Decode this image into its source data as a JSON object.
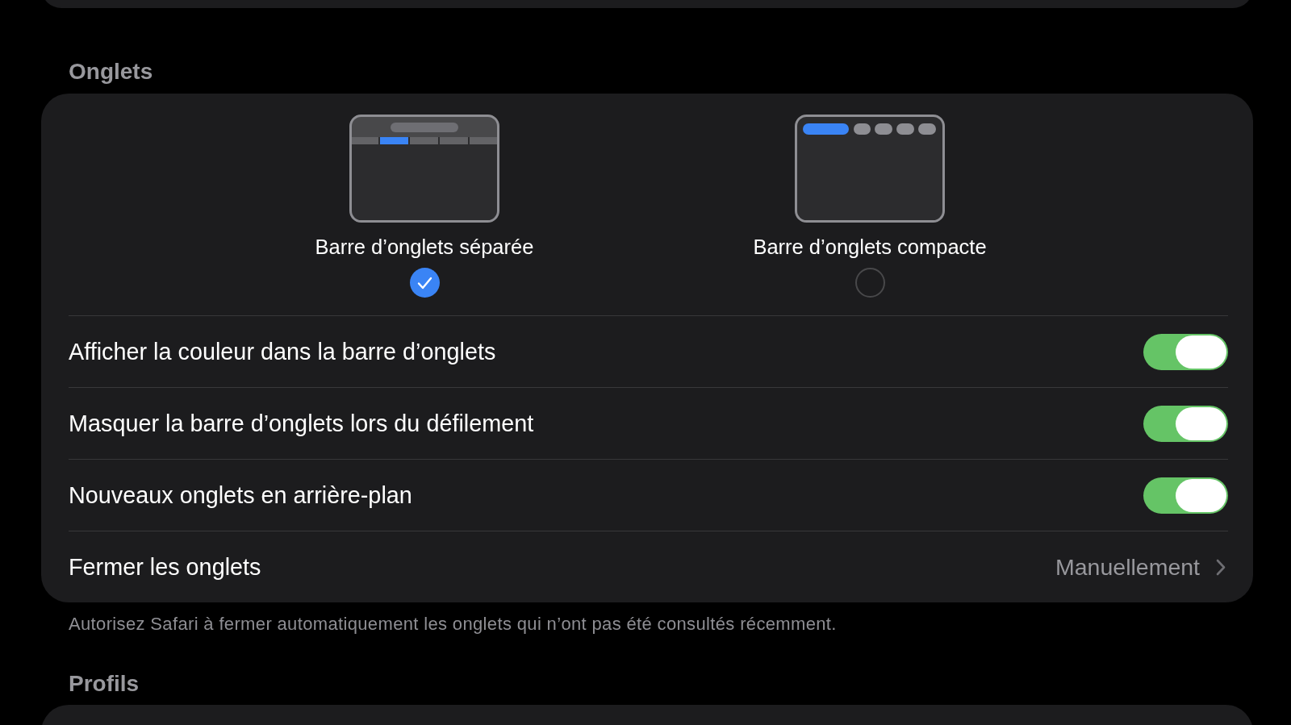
{
  "tabs_section": {
    "header": "Onglets",
    "layouts": [
      {
        "kind": "separate",
        "label": "Barre d’onglets séparée",
        "selected": true
      },
      {
        "kind": "compact",
        "label": "Barre d’onglets compacte",
        "selected": false
      }
    ],
    "rows": [
      {
        "kind": "toggle",
        "label": "Afficher la couleur dans la barre d’onglets",
        "on": true
      },
      {
        "kind": "toggle",
        "label": "Masquer la barre d’onglets lors du défilement",
        "on": true
      },
      {
        "kind": "toggle",
        "label": "Nouveaux onglets en arrière-plan",
        "on": true
      },
      {
        "kind": "disclosure",
        "label": "Fermer les onglets",
        "value": "Manuellement"
      }
    ],
    "footer": "Autorisez Safari à fermer automatiquement les onglets qui n’ont pas été consultés récemment."
  },
  "profiles_section": {
    "header": "Profils"
  }
}
